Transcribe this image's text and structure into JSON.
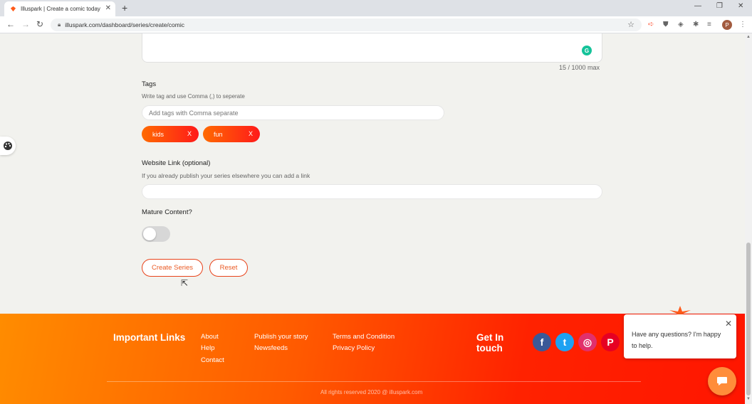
{
  "browser": {
    "tab_title": "Illuspark | Create a comic today",
    "tab_close": "✕",
    "new_tab": "+",
    "url": "illuspark.com/dashboard/series/create/comic",
    "profile_initial": "P",
    "window_controls": [
      "—",
      "❐",
      "✕"
    ]
  },
  "form": {
    "char_count": "15 / 1000 max",
    "grammarly_badge": "G",
    "tags_label": "Tags",
    "tags_hint": "Write tag and use Comma (,) to seperate",
    "tags_placeholder": "Add tags with Comma separate",
    "tags": [
      {
        "label": "kids",
        "remove": "X"
      },
      {
        "label": "fun",
        "remove": "X"
      }
    ],
    "website_label": "Website Link (optional)",
    "website_hint": "If you already publish your series elsewhere you can add a link",
    "website_value": "",
    "mature_label": "Mature Content?",
    "mature_enabled": false,
    "create_button": "Create Series",
    "reset_button": "Reset"
  },
  "footer": {
    "important_links_heading": "Important Links",
    "links_col1": [
      "About",
      "Help",
      "Contact"
    ],
    "links_col2": [
      "Publish your story",
      "Newsfeeds"
    ],
    "links_col3": [
      "Terms and Condition",
      "Privacy Policy"
    ],
    "get_in_touch": [
      "Get In",
      "touch"
    ],
    "socials": [
      {
        "icon": "facebook-icon",
        "glyph": "f",
        "color": "#3b5998"
      },
      {
        "icon": "twitter-icon",
        "glyph": "t",
        "color": "#1da1f2"
      },
      {
        "icon": "instagram-icon",
        "glyph": "◎",
        "color": "#e1306c"
      },
      {
        "icon": "pinterest-icon",
        "glyph": "P",
        "color": "#e60023"
      }
    ],
    "copyright": "All rights reserved 2020 @ illuspark.com"
  },
  "chat": {
    "message": "Have any questions? I'm happy to help.",
    "close": "✕"
  },
  "colors": {
    "accent": "#ff4d1a",
    "button_text": "#ea5a24",
    "footer_start": "#ff8c00",
    "footer_end": "#ff1600"
  }
}
